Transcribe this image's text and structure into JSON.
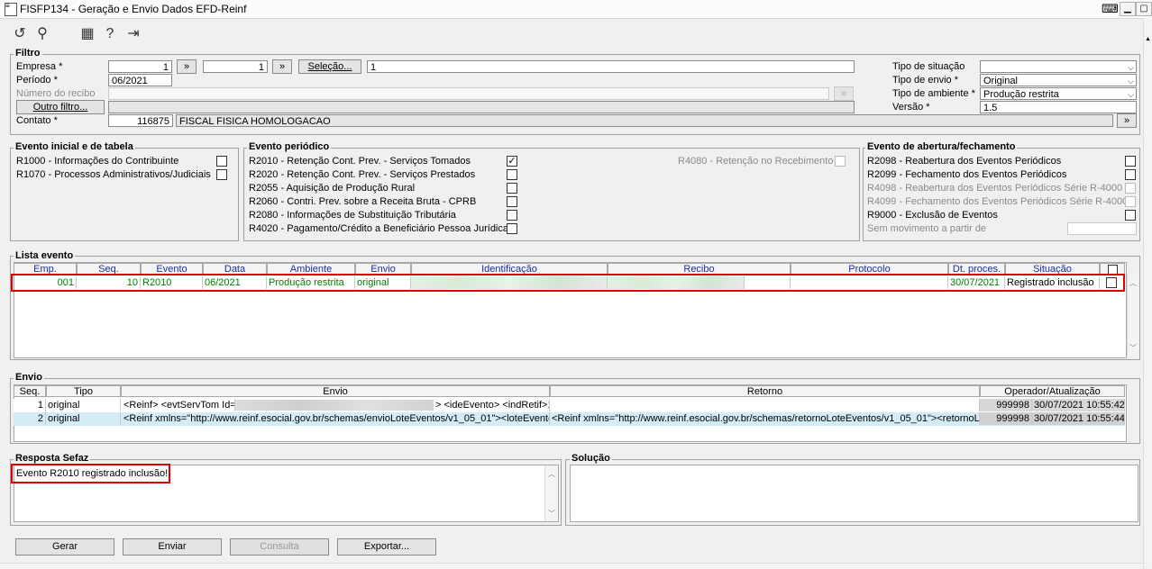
{
  "window": {
    "title": "FISFP134 - Geração e Envio Dados EFD-Reinf"
  },
  "filtro": {
    "title": "Filtro",
    "empresa_label": "Empresa *",
    "empresa_from": "1",
    "empresa_to": "1",
    "selecao_label": "Seleção...",
    "selecao_value": "1",
    "periodo_label": "Período *",
    "periodo_value": "06/2021",
    "recibo_label": "Número do recibo",
    "outro_filtro_label": "Outro filtro...",
    "contato_label": "Contato *",
    "contato_code": "116875",
    "contato_name": "FISCAL FISICA HOMOLOGACAO",
    "tipo_situacao_label": "Tipo de situação",
    "tipo_situacao_value": "",
    "tipo_envio_label": "Tipo de envio *",
    "tipo_envio_value": "Original",
    "tipo_ambiente_label": "Tipo de ambiente *",
    "tipo_ambiente_value": "Produção restrita",
    "versao_label": "Versão *",
    "versao_value": "1.5",
    "arrow": "»"
  },
  "evento_inicial": {
    "title": "Evento inicial e de tabela",
    "items": [
      {
        "label": "R1000 - Informações do Contribuinte",
        "checked": false
      },
      {
        "label": "R1070 - Processos Administrativos/Judiciais",
        "checked": false
      }
    ]
  },
  "evento_periodico": {
    "title": "Evento periódico",
    "items": [
      {
        "label": "R2010 - Retenção Cont. Prev. - Serviços Tomados",
        "checked": true
      },
      {
        "label": "R2020 - Retenção Cont. Prev. - Serviços Prestados",
        "checked": false
      },
      {
        "label": "R2055 - Aquisição de Produção Rural",
        "checked": false
      },
      {
        "label": "R2060 - Contri. Prev. sobre a Receita Bruta - CPRB",
        "checked": false
      },
      {
        "label": "R2080 - Informações de Substituição Tributária",
        "checked": false
      },
      {
        "label": "R4020 - Pagamento/Crédito a Beneficiário Pessoa Jurídica",
        "checked": false
      }
    ],
    "r4080_label": "R4080 - Retenção no Recebimento"
  },
  "evento_abertura": {
    "title": "Evento de abertura/fechamento",
    "items": [
      {
        "label": "R2098 - Reabertura dos Eventos Periódicos",
        "enabled": true
      },
      {
        "label": "R2099 - Fechamento dos Eventos Periódicos",
        "enabled": true
      },
      {
        "label": "R4098 - Reabertura dos Eventos Periódicos Série R-4000",
        "enabled": false
      },
      {
        "label": "R4099 - Fechamento dos Eventos Periódicos Série R-4000",
        "enabled": false
      },
      {
        "label": "R9000 - Exclusão de Eventos",
        "enabled": true
      }
    ],
    "sem_movimento_label": "Sem movimento a partir de"
  },
  "lista_evento": {
    "title": "Lista evento",
    "columns": [
      "Emp.",
      "Seq.",
      "Evento",
      "Data",
      "Ambiente",
      "Envio",
      "Identificação",
      "Recibo",
      "Protocolo",
      "Dt. proces.",
      "Situação"
    ],
    "rows": [
      {
        "emp": "001",
        "seq": "10",
        "evento": "R2010",
        "data": "06/2021",
        "ambiente": "Produção restrita",
        "envio": "original",
        "identificacao": "",
        "recibo": "",
        "protocolo": "",
        "dt_proces": "30/07/2021",
        "situacao": "Registrado inclusão"
      }
    ]
  },
  "envio": {
    "title": "Envio",
    "columns": [
      "Seq.",
      "Tipo",
      "Envio",
      "Retorno",
      "Operador/Atualização"
    ],
    "rows": [
      {
        "seq": "1",
        "tipo": "original",
        "envio_a": "<Reinf> <evtServTom Id=\"I",
        "envio_b": "> <ideEvento> <indRetif>1",
        "retorno": "",
        "operador": "999998",
        "atualizacao": "30/07/2021 10:55:42"
      },
      {
        "seq": "2",
        "tipo": "original",
        "envio_a": "<Reinf xmlns=\"http://www.reinf.esocial.gov.br/schemas/envioLoteEventos/v1_05_01\"><loteEvento",
        "envio_b": "",
        "retorno": "<Reinf xmlns=\"http://www.reinf.esocial.gov.br/schemas/retornoLoteEventos/v1_05_01\"><retornoL",
        "operador": "999998",
        "atualizacao": "30/07/2021 10:55:44"
      }
    ]
  },
  "resposta": {
    "title": "Resposta Sefaz",
    "text": "Evento R2010 registrado inclusão!"
  },
  "solucao": {
    "title": "Solução",
    "text": ""
  },
  "buttons": {
    "gerar": "Gerar",
    "enviar": "Enviar",
    "consulta": "Consulta",
    "exportar": "Exportar..."
  },
  "colors": {
    "highlight": "#e00000",
    "grid_text": "#008000",
    "header_text": "#1a2fa0"
  }
}
